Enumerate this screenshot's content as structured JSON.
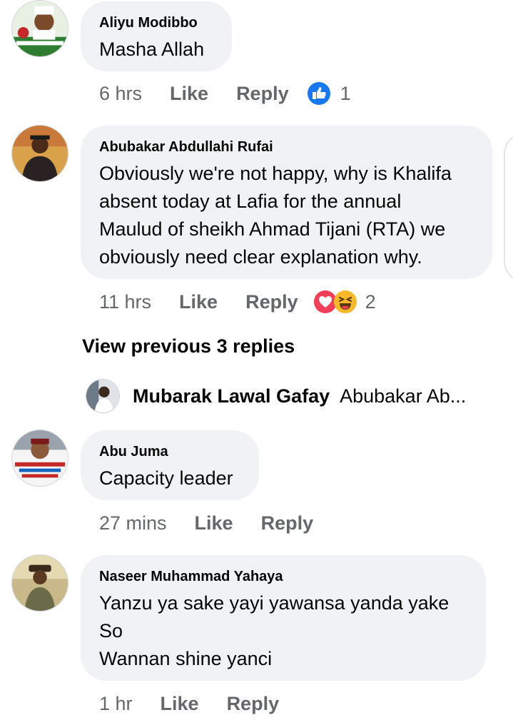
{
  "comments": [
    {
      "author": "Aliyu Modibbo",
      "text": [
        "Masha Allah"
      ],
      "time": "6 hrs",
      "like": "Like",
      "reply": "Reply",
      "reaction_count": "1",
      "reactions": [
        "like-icon"
      ]
    },
    {
      "author": "Abubakar Abdullahi Rufai",
      "text": [
        "Obviously we're not happy, why is Khalifa",
        "absent today at Lafia for the annual",
        "Maulud of sheikh Ahmad Tijani (RTA) we",
        "obviously need clear explanation why."
      ],
      "time": "11 hrs",
      "like": "Like",
      "reply": "Reply",
      "reaction_count": "2",
      "reactions": [
        "love-icon",
        "haha-icon"
      ]
    },
    {
      "author": "Abu Juma",
      "text": [
        "Capacity leader"
      ],
      "time": "27 mins",
      "like": "Like",
      "reply": "Reply"
    },
    {
      "author": "Naseer Muhammad Yahaya",
      "text": [
        "Yanzu ya sake yayi yawansa yanda yake",
        "So",
        "Wannan shine yanci"
      ],
      "time": "1 hr",
      "like": "Like",
      "reply": "Reply"
    }
  ],
  "view_previous": "View previous 3 replies",
  "reply_preview": {
    "author": "Mubarak Lawal Gafay",
    "text": "Abubakar Ab..."
  },
  "colors": {
    "bubble": "#f0f2f5",
    "meta": "#65676b",
    "like_blue": "#1877f2",
    "love_red": "#f33e58",
    "haha_yellow": "#f7b928"
  }
}
